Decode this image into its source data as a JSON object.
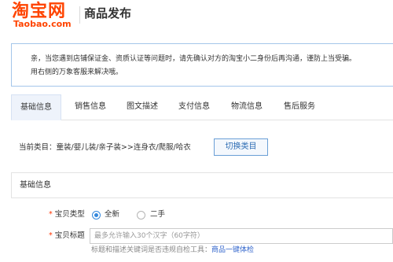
{
  "header": {
    "logo_text": "淘宝网",
    "logo_domain": "Taobao.com",
    "page_title": "商品发布"
  },
  "notice": {
    "line1": "亲，当您遇到店铺保证金、资质认证等问题时，请先确认对方的淘宝小二身份后再沟通，谨防上当受骗。",
    "line2": "用右侧的万象客服来解决哦。"
  },
  "tabs": [
    {
      "label": "基础信息",
      "active": true
    },
    {
      "label": "销售信息",
      "active": false
    },
    {
      "label": "图文描述",
      "active": false
    },
    {
      "label": "支付信息",
      "active": false
    },
    {
      "label": "物流信息",
      "active": false
    },
    {
      "label": "售后服务",
      "active": false
    }
  ],
  "category": {
    "current_label": "当前类目：童装/婴儿装/亲子装>>连身衣/爬服/哈衣",
    "switch_button": "切换类目"
  },
  "section": {
    "title": "基础信息"
  },
  "form": {
    "item_type": {
      "required_mark": "*",
      "label": "宝贝类型",
      "options": [
        {
          "label": "全新",
          "checked": true
        },
        {
          "label": "二手",
          "checked": false
        }
      ]
    },
    "item_title": {
      "required_mark": "*",
      "label": "宝贝标题",
      "value": "",
      "placeholder": "最多允许输入30个汉字（60字符）",
      "hint_text": "标题和描述关键词是否违规自检工具：",
      "hint_link": "商品一键体检"
    }
  },
  "colors": {
    "brand": "#ff4400",
    "accent": "#3388dd",
    "link": "#3366cc",
    "notice_border": "#a4c6ea",
    "required": "#ff3300"
  }
}
